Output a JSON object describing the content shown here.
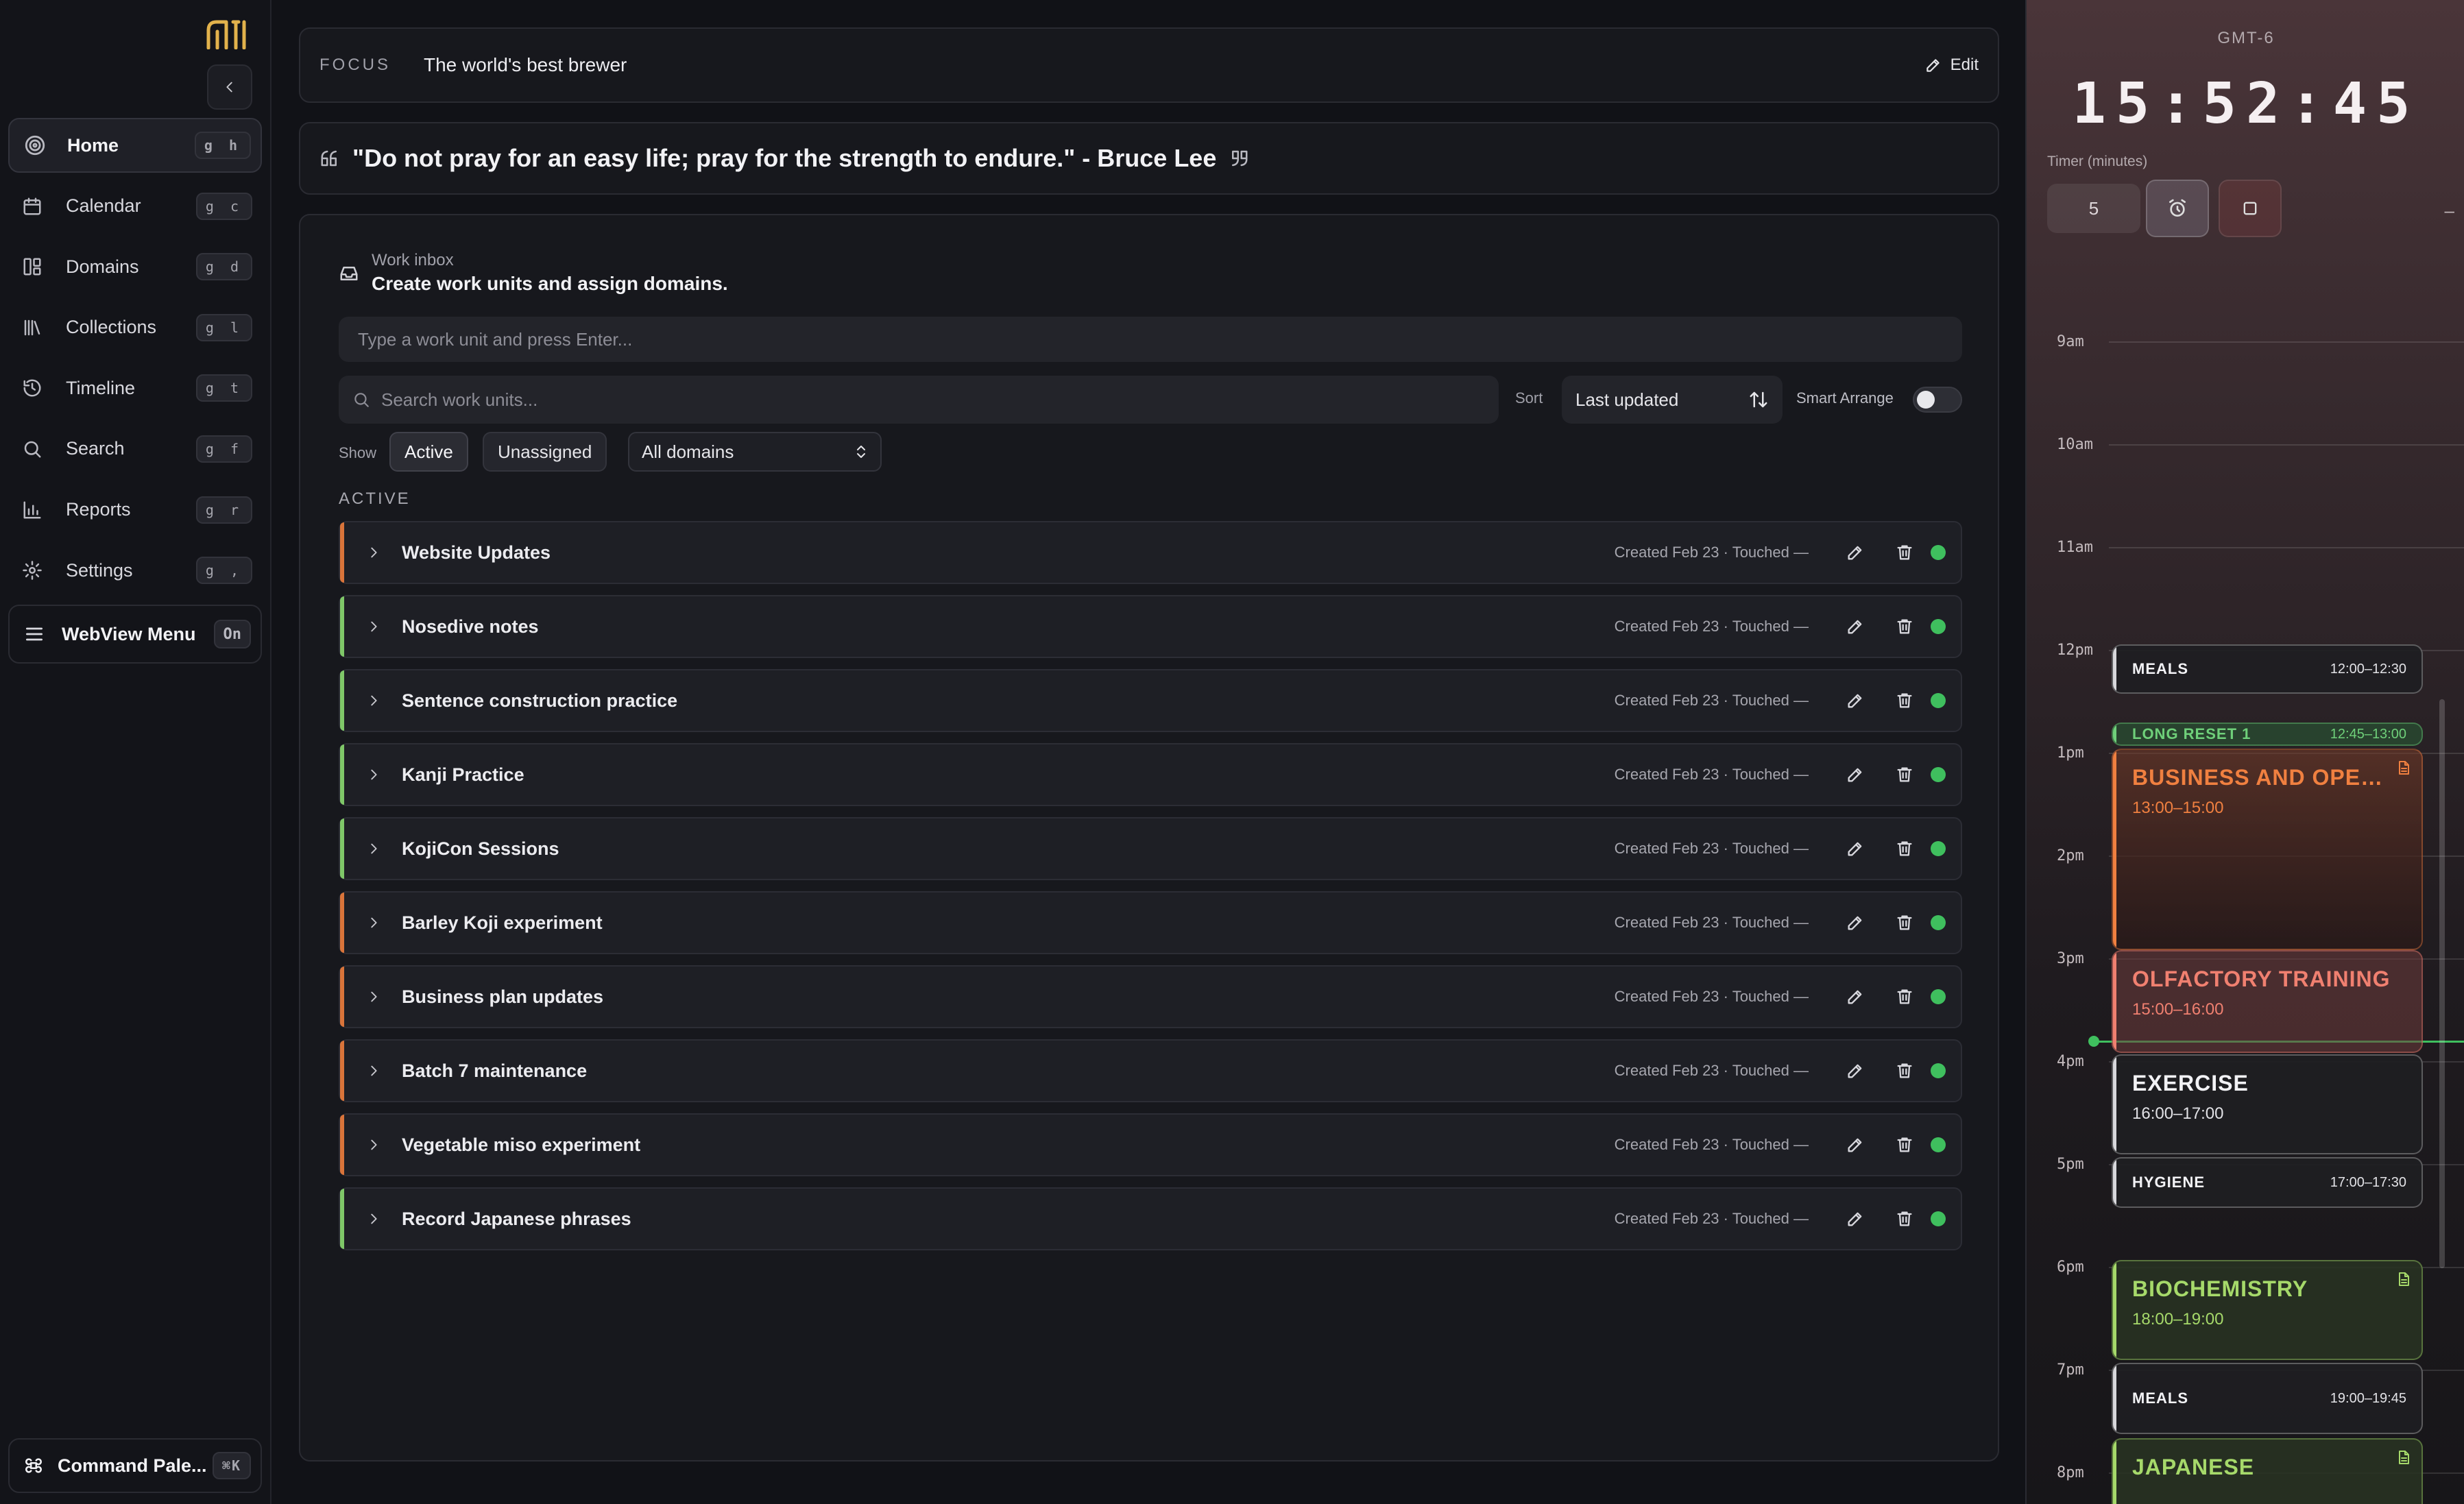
{
  "app": {
    "logo_label": "MI logo"
  },
  "sidebar": {
    "items": [
      {
        "label": "Home",
        "shortcut": "g h",
        "icon": "target-icon",
        "active": true
      },
      {
        "label": "Calendar",
        "shortcut": "g c",
        "icon": "calendar-icon"
      },
      {
        "label": "Domains",
        "shortcut": "g d",
        "icon": "layout-icon"
      },
      {
        "label": "Collections",
        "shortcut": "g l",
        "icon": "library-icon"
      },
      {
        "label": "Timeline",
        "shortcut": "g t",
        "icon": "history-icon"
      },
      {
        "label": "Search",
        "shortcut": "g f",
        "icon": "search-icon"
      },
      {
        "label": "Reports",
        "shortcut": "g r",
        "icon": "bar-chart-icon"
      },
      {
        "label": "Settings",
        "shortcut": "g ,",
        "icon": "gear-icon"
      }
    ],
    "webview": {
      "label": "WebView Menu",
      "state": "On"
    },
    "command_palette": {
      "label": "Command Pale...",
      "shortcut": "⌘K"
    }
  },
  "focus": {
    "label": "FOCUS",
    "text": "The world's best brewer",
    "edit_label": "Edit"
  },
  "quote": {
    "text": "\"Do not pray for an easy life; pray for the strength to endure.\" - Bruce Lee"
  },
  "inbox": {
    "subtitle": "Work inbox",
    "title": "Create work units and assign domains.",
    "input_placeholder": "Type a work unit and press Enter...",
    "search_placeholder": "Search work units...",
    "sort_label": "Sort",
    "sort_value": "Last updated",
    "smart_arrange_label": "Smart Arrange",
    "smart_arrange_on": false,
    "show_label": "Show",
    "filter_active": "Active",
    "filter_unassigned": "Unassigned",
    "domains_value": "All domains",
    "section_title": "ACTIVE",
    "status_color": "#3fbf5e",
    "rows": [
      {
        "title": "Website Updates",
        "meta": "Created Feb 23 · Touched —",
        "accent": "#d9743a"
      },
      {
        "title": "Nosedive notes",
        "meta": "Created Feb 23 · Touched —",
        "accent": "#7fc768"
      },
      {
        "title": "Sentence construction practice",
        "meta": "Created Feb 23 · Touched —",
        "accent": "#7fc768"
      },
      {
        "title": "Kanji Practice",
        "meta": "Created Feb 23 · Touched —",
        "accent": "#7fc768"
      },
      {
        "title": "KojiCon Sessions",
        "meta": "Created Feb 23 · Touched —",
        "accent": "#7fc768"
      },
      {
        "title": "Barley Koji experiment",
        "meta": "Created Feb 23 · Touched —",
        "accent": "#d9743a"
      },
      {
        "title": "Business plan updates",
        "meta": "Created Feb 23 · Touched —",
        "accent": "#d9743a"
      },
      {
        "title": "Batch 7 maintenance",
        "meta": "Created Feb 23 · Touched —",
        "accent": "#d9743a"
      },
      {
        "title": "Vegetable miso experiment",
        "meta": "Created Feb 23 · Touched —",
        "accent": "#d9743a"
      },
      {
        "title": "Record Japanese phrases",
        "meta": "Created Feb 23 · Touched —",
        "accent": "#7fc768"
      }
    ]
  },
  "clock": {
    "timezone": "GMT-6",
    "time": "15:52:45",
    "timer_label": "Timer (minutes)",
    "timer_value": "5"
  },
  "schedule": {
    "hours": [
      "9am",
      "10am",
      "11am",
      "12pm",
      "1pm",
      "2pm",
      "3pm",
      "4pm",
      "5pm",
      "6pm",
      "7pm",
      "8pm"
    ],
    "events": [
      {
        "name": "MEALS",
        "time": "12:00–12:30",
        "color": "#ffffff",
        "style": "small"
      },
      {
        "name": "LONG RESET 1",
        "time": "12:45–13:00",
        "color": "#6fd07a",
        "style": "small"
      },
      {
        "name": "BUSINESS AND OPERATI...",
        "time": "13:00–15:00",
        "color": "#f08040",
        "style": "big"
      },
      {
        "name": "OLFACTORY TRAINING",
        "time": "15:00–16:00",
        "color": "#f08070",
        "style": "big"
      },
      {
        "name": "EXERCISE",
        "time": "16:00–17:00",
        "color": "#ffffff",
        "style": "big"
      },
      {
        "name": "HYGIENE",
        "time": "17:00–17:30",
        "color": "#ffffff",
        "style": "small"
      },
      {
        "name": "BIOCHEMISTRY",
        "time": "18:00–19:00",
        "color": "#a6d96a",
        "style": "big"
      },
      {
        "name": "MEALS",
        "time": "19:00–19:45",
        "color": "#ffffff",
        "style": "small"
      },
      {
        "name": "JAPANESE",
        "time": "",
        "color": "#a6d96a",
        "style": "big"
      }
    ]
  }
}
